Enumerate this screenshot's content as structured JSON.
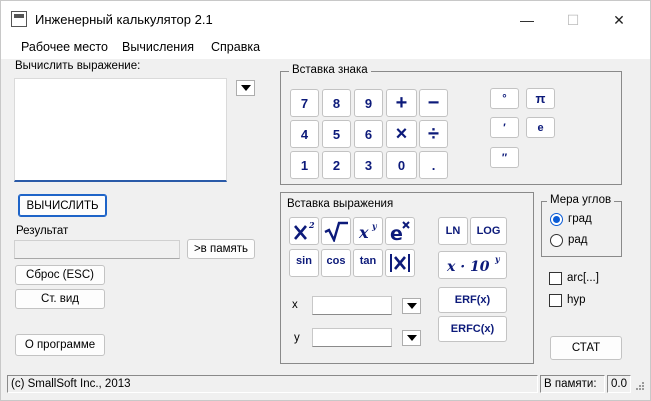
{
  "window": {
    "title": "Инженерный калькулятор 2.1",
    "controls": {
      "minimize": "—",
      "maximize": "☐",
      "close": "✕"
    }
  },
  "menu": [
    "Рабочее место",
    "Вычисления",
    "Справка"
  ],
  "left": {
    "expr_label": "Вычислить выражение:",
    "compute": "ВЫЧИСЛИТЬ",
    "result_label": "Результат",
    "to_memory": ">в память",
    "reset": "Сброс (ESC)",
    "std_view": "Ст. вид",
    "about": "О программе"
  },
  "sign_panel": {
    "title": "Вставка знака",
    "keys": [
      "7",
      "8",
      "9",
      "+",
      "−",
      "4",
      "5",
      "6",
      "×",
      "÷",
      "1",
      "2",
      "3",
      "0",
      "."
    ],
    "extra": [
      "°",
      "π",
      "′",
      "e",
      "″"
    ]
  },
  "expr_panel": {
    "title": "Вставка выражения",
    "functions": [
      "sin",
      "cos",
      "tan",
      "LN",
      "LOG",
      "ERF(x)",
      "ERFC(x)"
    ],
    "x_label": "x",
    "y_label": "y"
  },
  "angle": {
    "title": "Мера углов",
    "options": [
      "град",
      "рад"
    ],
    "selected": "град"
  },
  "flags": [
    "arc[...]",
    "hyp"
  ],
  "stat": "СТАТ",
  "status": {
    "copyright": "(c) SmallSoft Inc., 2013",
    "memory_label": "В памяти:",
    "memory_value": "0.0"
  }
}
